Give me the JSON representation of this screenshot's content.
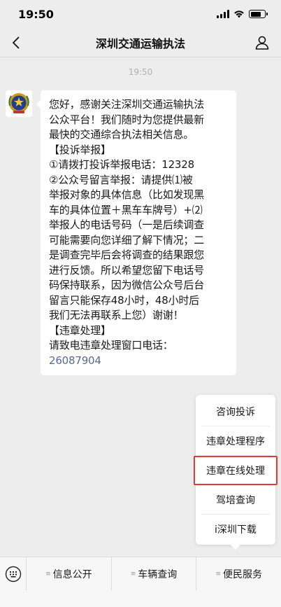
{
  "status": {
    "time": "19:50"
  },
  "nav": {
    "title": "深圳交通运输执法"
  },
  "chat": {
    "timestamp": "19:50",
    "message_lines": [
      "您好，感谢关注深圳交通运输执法",
      "公众平台！我们随时为您提供最新",
      "最快的交通综合执法相关信息。",
      "【投诉举报】",
      "①请拨打投诉举报电话：12328",
      "②公众号留言举报：请提供⑴被",
      "举报对象的具体信息（比如发现黑",
      "车的具体位置＋黑车车牌号）+⑵",
      "举报人的电话号码（一是后续调查",
      "可能需要向您详细了解下情况；二",
      "是调查完毕后会将调查的结果跟您",
      "进行反馈。所以希望您留下电话号",
      "码保持联系，因为微信公众号后台",
      "留言只能保存48小时，48小时后",
      "我们无法再联系上您）谢谢！",
      "【违章处理】",
      "请致电违章处理窗口电话："
    ],
    "phone": "26087904"
  },
  "popup_menu": {
    "items": [
      "咨询投诉",
      "违章处理程序",
      "违章在线处理",
      "驾培查询",
      "i深圳下载"
    ]
  },
  "bottom_menu": {
    "tabs": [
      "信息公开",
      "车辆查询",
      "便民服务"
    ]
  },
  "colors": {
    "highlight_border": "#e03a3a",
    "link": "#576b95"
  }
}
